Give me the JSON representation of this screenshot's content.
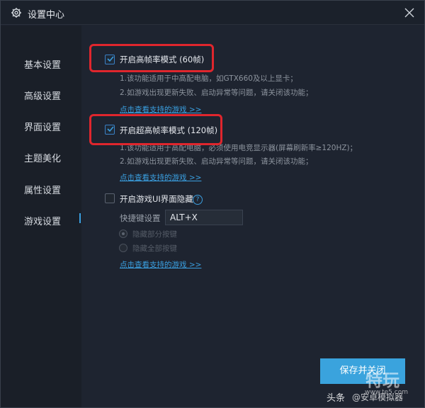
{
  "window": {
    "title": "设置中心",
    "icon": "gear-icon",
    "close_icon": "close-icon"
  },
  "sidebar": {
    "items": [
      {
        "label": "基本设置"
      },
      {
        "label": "高级设置"
      },
      {
        "label": "界面设置"
      },
      {
        "label": "主题美化"
      },
      {
        "label": "属性设置"
      },
      {
        "label": "游戏设置",
        "active": true
      }
    ]
  },
  "game_settings": {
    "high_fps": {
      "label": "开启高帧率模式 (60帧)",
      "checked": true,
      "desc1": "1.该功能适用于中高配电脑，如GTX660及以上显卡；",
      "desc2": "2.如游戏出现更新失败、启动异常等问题，请关闭该功能；",
      "link": "点击查看支持的游戏 >>"
    },
    "ultra_fps": {
      "label": "开启超高帧率模式 (120帧)",
      "checked": true,
      "desc1": "1.该功能适用于高配电脑，必须使用电竞显示器(屏幕刷新率≥120HZ)；",
      "desc2": "2.如游戏出现更新失败、启动异常等问题，请关闭该功能；",
      "link": "点击查看支持的游戏 >>"
    },
    "hide_ui": {
      "label": "开启游戏UI界面隐藏",
      "checked": false,
      "help": "?",
      "hotkey_label": "快捷键设置",
      "hotkey_value": "ALT+X",
      "radio1": "隐藏部分按键",
      "radio2": "隐藏全部按键",
      "link": "点击查看支持的游戏 >>"
    }
  },
  "footer": {
    "save_label": "保存并关闭"
  },
  "watermark": {
    "site": "特玩",
    "url": "www.te5.com",
    "toutiao": "头条",
    "account": "@安卓模拟器"
  },
  "colors": {
    "accent": "#3aa3dd",
    "highlight": "#e0262d",
    "background": "#1f2530"
  }
}
